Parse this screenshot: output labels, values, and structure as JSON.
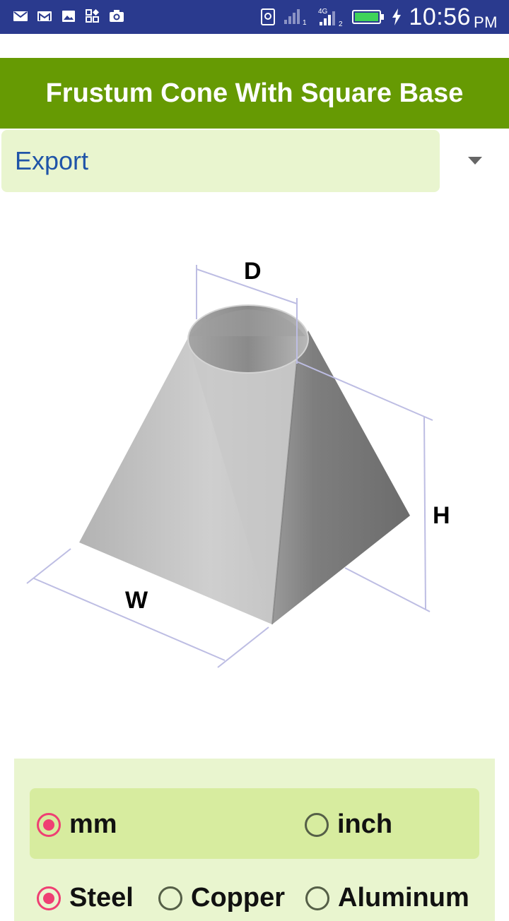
{
  "status_bar": {
    "time": "10:56",
    "ampm": "PM",
    "network_label": "4G",
    "sim1": "1",
    "sim2": "2",
    "icons": [
      "mail-icon",
      "gmail-icon",
      "image-icon",
      "app-grid-icon",
      "camera-icon",
      "sim-card-icon",
      "signal-icon",
      "battery-icon",
      "charging-icon"
    ]
  },
  "title": "Frustum Cone With Square Base",
  "spinner": {
    "selected": "Export"
  },
  "figure": {
    "labels": {
      "d": "D",
      "h": "H",
      "w": "W"
    }
  },
  "units": {
    "options": [
      {
        "label": "mm",
        "checked": true
      },
      {
        "label": "inch",
        "checked": false
      }
    ]
  },
  "materials": {
    "options": [
      {
        "label": "Steel",
        "checked": true
      },
      {
        "label": "Copper",
        "checked": false
      },
      {
        "label": "Aluminum",
        "checked": false
      }
    ]
  },
  "colors": {
    "status_bar": "#2a3a8e",
    "title_bar": "#669a03",
    "panel": "#e9f5cf",
    "unit_row": "#d7ec9f",
    "spinner_text": "#1f54a8",
    "radio_checked": "#ef3f73"
  }
}
